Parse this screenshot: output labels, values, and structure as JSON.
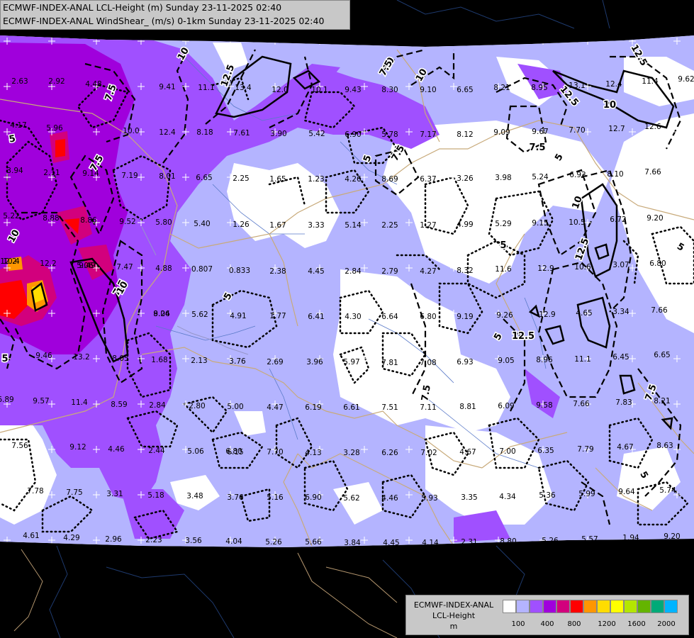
{
  "header": {
    "line1": "ECMWF-INDEX-ANAL LCL-Height (m) Sunday 23-11-2025 02:40",
    "line2": "ECMWF-INDEX-ANAL WindShear_ (m/s) 0-1km Sunday 23-11-2025 02:40"
  },
  "legend": {
    "title_line1": "ECMWF-INDEX-ANAL",
    "title_line2": "LCL-Height",
    "unit": "m",
    "swatches": [
      "#ffffff",
      "#b4b4ff",
      "#a050ff",
      "#a000dc",
      "#d2007d",
      "#ff0000",
      "#ff9600",
      "#ffdc00",
      "#ffff00",
      "#b4e600",
      "#64b400",
      "#00aa78",
      "#00b4ff"
    ],
    "ticks": [
      "100",
      "400",
      "800",
      "1200",
      "1600",
      "2000"
    ]
  },
  "contour_labels": [
    "10",
    "12.5",
    "7.5",
    "5",
    "10",
    "7.5",
    "10",
    "12.5",
    "7.5",
    "5",
    "10",
    "12.5",
    "7.5",
    "5",
    "7.5",
    "5",
    "12.5",
    "10",
    "5",
    "7.5",
    "5",
    "7.5",
    "5",
    "10",
    "7.5",
    "5",
    "5",
    "10",
    "12.5"
  ],
  "values": [
    "2.63",
    "2.92",
    "4.48",
    "9.41",
    "11.1",
    "13.4",
    "12.0",
    "10.1",
    "9.43",
    "8.30",
    "9.10",
    "6.65",
    "8.21",
    "8.95",
    "13.1",
    "12.4",
    "11.4",
    "9.62",
    "4.17",
    "5.96",
    "10.0",
    "12.4",
    "8.18",
    "7.61",
    "3.90",
    "5.42",
    "6.90",
    "5.78",
    "7.17",
    "8.12",
    "9.09",
    "9.67",
    "7.70",
    "12.7",
    "12.6",
    "3.94",
    "2.11",
    "9.14",
    "7.19",
    "8.01",
    "6.65",
    "2.25",
    "1.65",
    "1.23",
    "4.26",
    "8.69",
    "6.37",
    "3.26",
    "3.98",
    "5.24",
    "6.93",
    "8.10",
    "7.66",
    "5.22",
    "8.88",
    "8.86",
    "9.52",
    "5.80",
    "5.40",
    "1.26",
    "1.67",
    "3.33",
    "5.14",
    "2.25",
    "1.27",
    "4.99",
    "5.29",
    "9.15",
    "10.5",
    "6.72",
    "9.20",
    "10.4",
    "12.2",
    "9.49",
    "7.47",
    "4.88",
    "0.807",
    "0.833",
    "2.38",
    "4.45",
    "2.84",
    "2.79",
    "4.27",
    "8.32",
    "11.6",
    "12.9",
    "10.6",
    "3.07",
    "6.80",
    "8.24",
    "5.62",
    "4.91",
    "1.77",
    "6.41",
    "4.30",
    "6.64",
    "6.80",
    "9.19",
    "9.26",
    "12.9",
    "4.65",
    "3.34",
    "7.66",
    "9.46",
    "13.2",
    "8.05",
    "1.68",
    "2.13",
    "3.76",
    "2.69",
    "3.96",
    "5.97",
    "7.81",
    "7.08",
    "6.93",
    "9.05",
    "8.96",
    "11.1",
    "6.45",
    "6.65",
    "6.89",
    "9.57",
    "11.4",
    "8.59",
    "2.84",
    "2.80",
    "5.00",
    "4.47",
    "6.19",
    "6.61",
    "7.51",
    "7.11",
    "8.81",
    "6.09",
    "9.58",
    "7.66",
    "7.83",
    "8.21",
    "7.56",
    "9.12",
    "4.46",
    "2.44",
    "5.06",
    "6.15",
    "7.70",
    "4.13",
    "3.28",
    "6.26",
    "7.02",
    "4.67",
    "7.00",
    "6.35",
    "7.79",
    "4.67",
    "8.63",
    "7.78",
    "7.75",
    "3.31",
    "5.18",
    "3.48",
    "3.76",
    "5.16",
    "6.90",
    "5.62",
    "4.46",
    "5.93",
    "3.35",
    "4.34",
    "5.36",
    "5.99",
    "9.64",
    "5.74",
    "4.61",
    "4.29",
    "2.96",
    "2.23",
    "3.56",
    "4.04",
    "5.26",
    "5.66",
    "3.84",
    "4.45",
    "4.14",
    "2.31",
    "8.80",
    "5.26",
    "5.57",
    "1.94",
    "9.20",
    "12.2",
    "5.06",
    "6.80",
    "9.06"
  ]
}
